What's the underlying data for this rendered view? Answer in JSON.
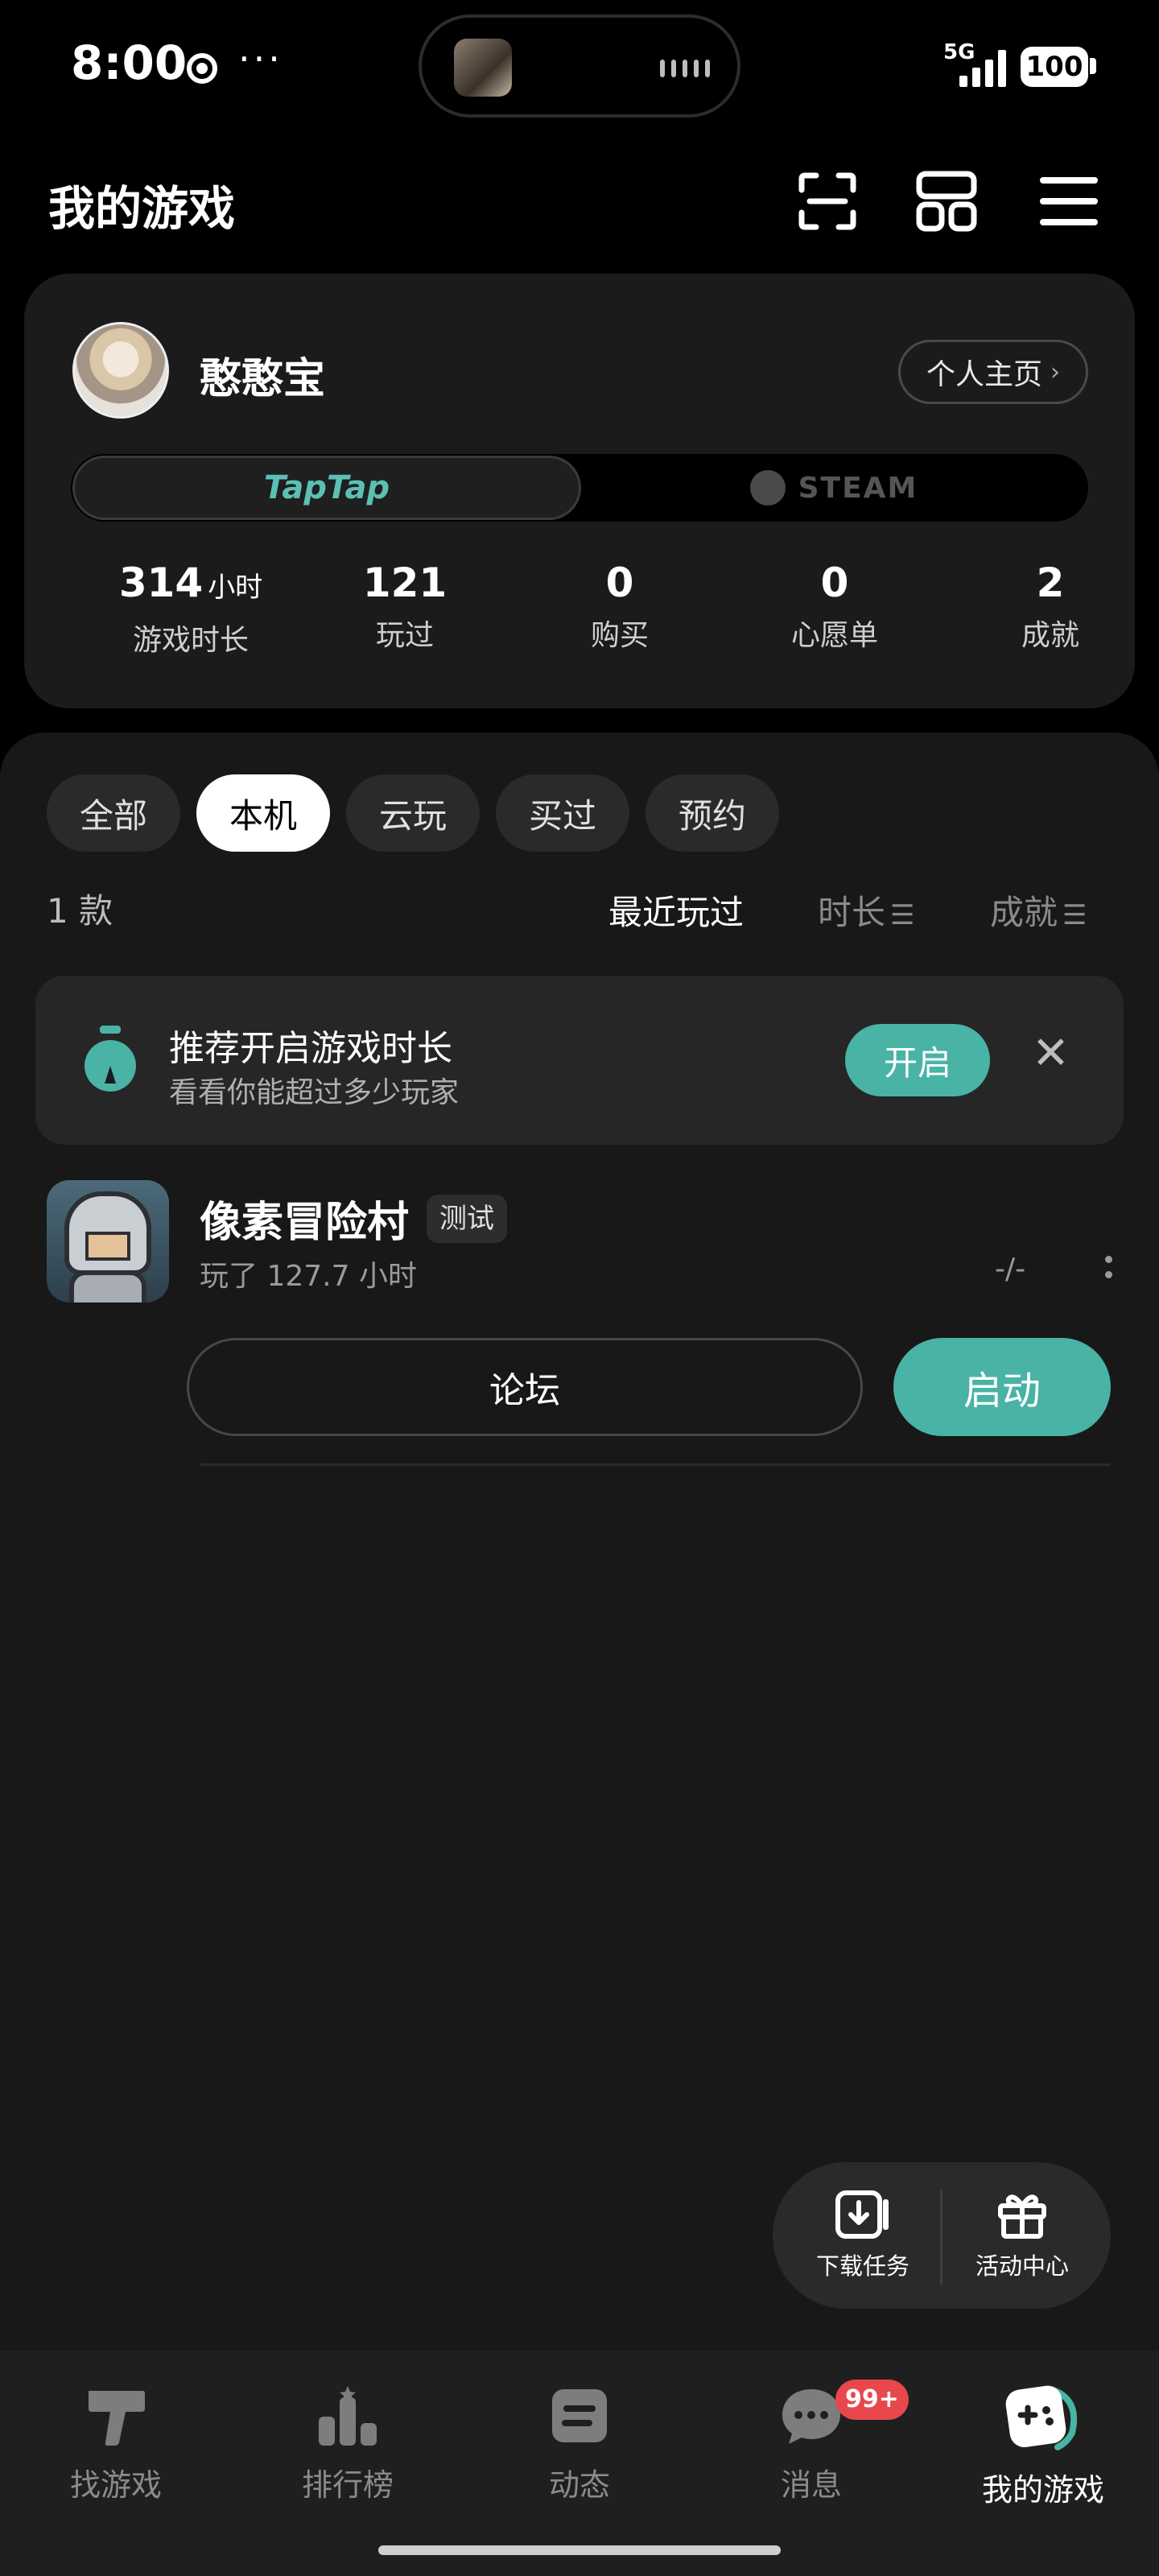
{
  "status_bar": {
    "time": "8:00",
    "dots": "···",
    "network": "5G",
    "battery": "100"
  },
  "header": {
    "title": "我的游戏"
  },
  "profile": {
    "name": "憨憨宝",
    "home_button": "个人主页",
    "platforms": {
      "taptap": "TapTap",
      "steam": "STEAM",
      "active": "TapTap"
    },
    "stats": [
      {
        "value": "314",
        "unit": "小时",
        "label": "游戏时长"
      },
      {
        "value": "121",
        "unit": "",
        "label": "玩过"
      },
      {
        "value": "0",
        "unit": "",
        "label": "购买"
      },
      {
        "value": "0",
        "unit": "",
        "label": "心愿单"
      },
      {
        "value": "2",
        "unit": "",
        "label": "成就"
      }
    ]
  },
  "filters": {
    "chips": [
      "全部",
      "本机",
      "云玩",
      "买过",
      "预约"
    ],
    "selected": "本机"
  },
  "list": {
    "count": "1 款",
    "sorts": [
      "最近玩过",
      "时长",
      "成就"
    ],
    "active_sort": "最近玩过"
  },
  "promo": {
    "title": "推荐开启游戏时长",
    "subtitle": "看看你能超过多少玩家",
    "button": "开启",
    "icon": "timer-icon"
  },
  "games": [
    {
      "name": "像素冒险村",
      "tag": "测试",
      "playtime": "玩了 127.7 小时",
      "score": "-/-",
      "forum_button": "论坛",
      "launch_button": "启动"
    }
  ],
  "float_actions": {
    "download": "下载任务",
    "activity": "活动中心"
  },
  "bottom_nav": {
    "items": [
      "找游戏",
      "排行榜",
      "动态",
      "消息",
      "我的游戏"
    ],
    "active": "我的游戏",
    "message_badge": "99+"
  },
  "colors": {
    "accent": "#49b3a5",
    "background": "#000000",
    "panel": "#181818",
    "badge": "#e8484b"
  }
}
